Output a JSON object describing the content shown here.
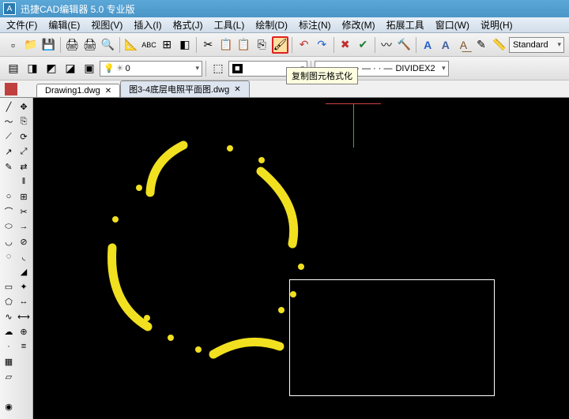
{
  "title": "迅捷CAD编辑器 5.0 专业版",
  "app_icon_label": "A",
  "menu": {
    "file": "文件(F)",
    "edit": "编辑(E)",
    "view": "视图(V)",
    "insert": "插入(I)",
    "format": "格式(J)",
    "tools": "工具(L)",
    "draw": "绘制(D)",
    "dim": "标注(N)",
    "modify": "修改(M)",
    "ext": "拓展工具",
    "window": "窗口(W)",
    "help": "说明(H)"
  },
  "toolbar": {
    "font_a": "A",
    "style_std": "Standard",
    "layer_value": "0",
    "color_swatch": "■",
    "linetype_value": "DIVIDEX2",
    "linetype_prefix": "— · · — · · — · · —"
  },
  "tooltip_text": "复制图元格式化",
  "tabs": {
    "t1": "Drawing1.dwg",
    "t2": "图3-4底层电照平面图.dwg"
  },
  "icons": {
    "new": "📄",
    "open": "📁",
    "save": "💾",
    "print": "🖨",
    "preview": "🔍",
    "find": "🔎",
    "cut": "✂",
    "copy": "📋",
    "paste": "📄",
    "brush": "🖌",
    "undo": "↶",
    "redo": "↷",
    "delete": "✖",
    "check": "✔",
    "hammer": "🔨",
    "layers": "▤"
  }
}
